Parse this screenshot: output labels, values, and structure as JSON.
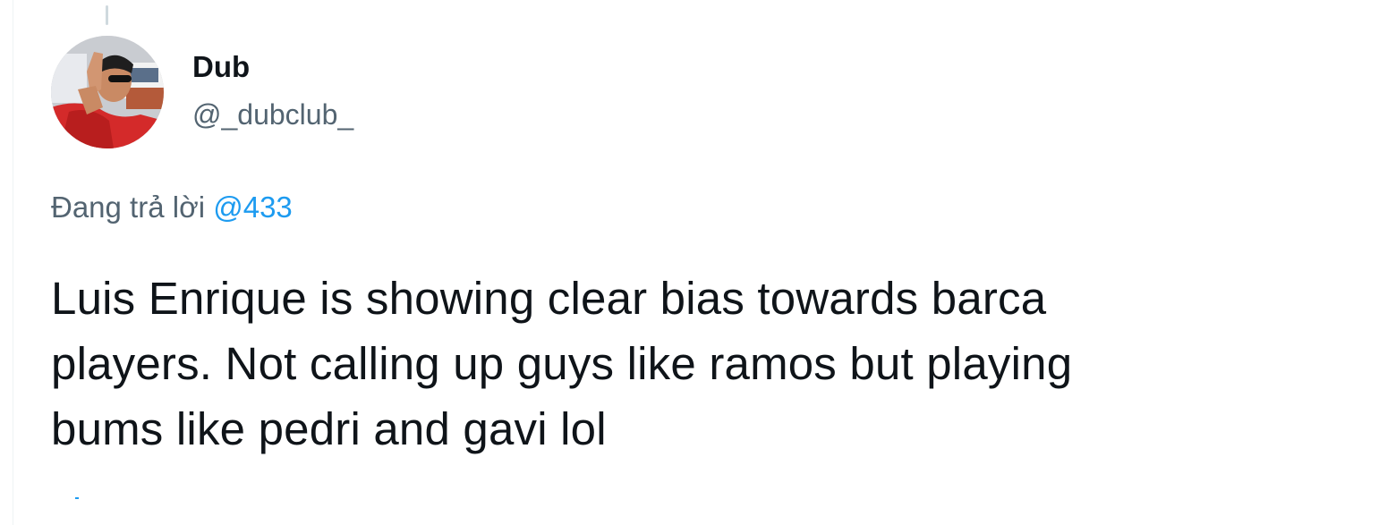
{
  "tweet": {
    "display_name": "Dub",
    "handle": "@_dubclub_",
    "reply_prefix": "Đang trả lời",
    "reply_to": "@433",
    "text_lines": [
      "Luis Enrique is showing clear bias towards barca",
      "players. Not calling up guys like ramos but playing",
      "bums like pedri and gavi lol"
    ]
  },
  "colors": {
    "text_primary": "#0f1419",
    "text_secondary": "#536471",
    "link": "#1d9bf0"
  }
}
